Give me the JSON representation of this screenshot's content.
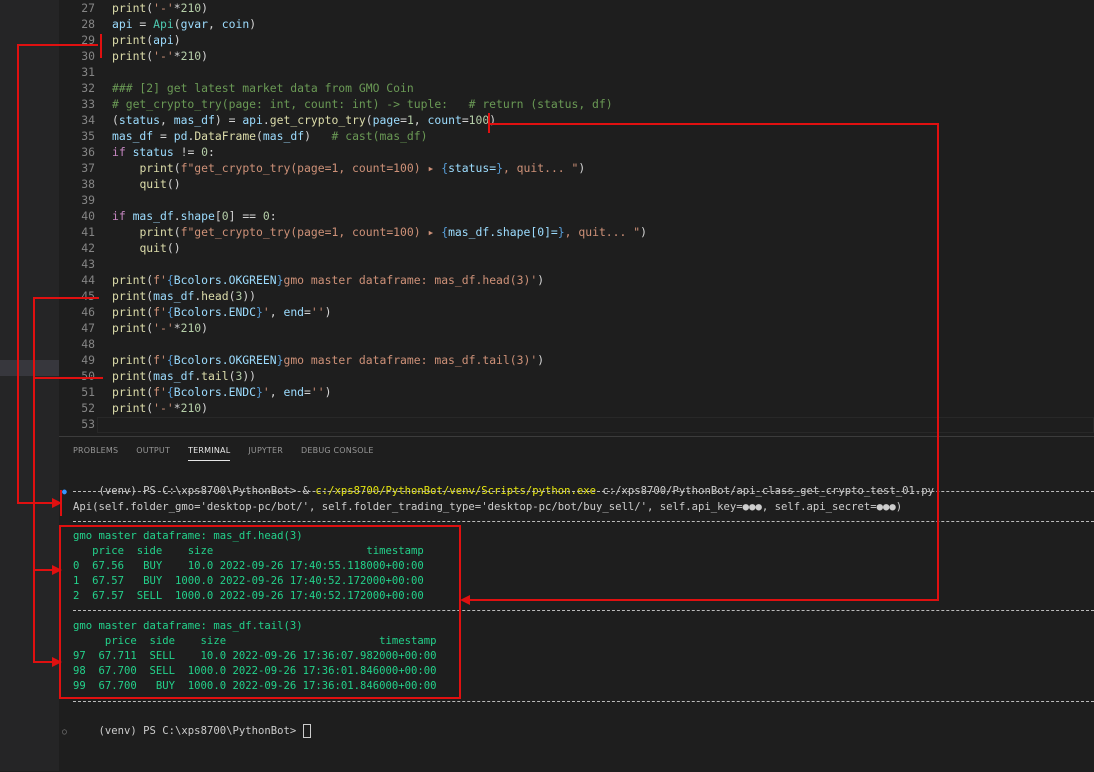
{
  "editor": {
    "lines": [
      {
        "n": "27",
        "t": "print('-'*210)"
      },
      {
        "n": "28",
        "t": "api = Api(gvar, coin)"
      },
      {
        "n": "29",
        "t": "print(api)"
      },
      {
        "n": "30",
        "t": "print('-'*210)"
      },
      {
        "n": "31",
        "t": ""
      },
      {
        "n": "32",
        "t": "### [2] get latest market data from GMO Coin"
      },
      {
        "n": "33",
        "t": "# get_crypto_try(page: int, count: int) -> tuple:   # return (status, df)"
      },
      {
        "n": "34",
        "t": "(status, mas_df) = api.get_crypto_try(page=1, count=100)"
      },
      {
        "n": "35",
        "t": "mas_df = pd.DataFrame(mas_df)   # cast(mas_df)"
      },
      {
        "n": "36",
        "t": "if status != 0:"
      },
      {
        "n": "37",
        "t": "    print(f\"get_crypto_try(page=1, count=100) ▸ {status=}, quit... \")"
      },
      {
        "n": "38",
        "t": "    quit()"
      },
      {
        "n": "39",
        "t": ""
      },
      {
        "n": "40",
        "t": "if mas_df.shape[0] == 0:"
      },
      {
        "n": "41",
        "t": "    print(f\"get_crypto_try(page=1, count=100) ▸ {mas_df.shape[0]=}, quit... \")"
      },
      {
        "n": "42",
        "t": "    quit()"
      },
      {
        "n": "43",
        "t": ""
      },
      {
        "n": "44",
        "t": "print(f'{Bcolors.OKGREEN}gmo master dataframe: mas_df.head(3)')"
      },
      {
        "n": "45",
        "t": "print(mas_df.head(3))"
      },
      {
        "n": "46",
        "t": "print(f'{Bcolors.ENDC}', end='')"
      },
      {
        "n": "47",
        "t": "print('-'*210)"
      },
      {
        "n": "48",
        "t": ""
      },
      {
        "n": "49",
        "t": "print(f'{Bcolors.OKGREEN}gmo master dataframe: mas_df.tail(3)')"
      },
      {
        "n": "50",
        "t": "print(mas_df.tail(3))"
      },
      {
        "n": "51",
        "t": "print(f'{Bcolors.ENDC}', end='')"
      },
      {
        "n": "52",
        "t": "print('-'*210)"
      },
      {
        "n": "53",
        "t": ""
      }
    ]
  },
  "panel": {
    "tabs": [
      "PROBLEMS",
      "OUTPUT",
      "TERMINAL",
      "JUPYTER",
      "DEBUG CONSOLE"
    ],
    "active_tab": "TERMINAL"
  },
  "terminal": {
    "prompt1_prefix": "(venv) PS C:\\xps8700\\PythonBot> & ",
    "prompt1_exe": "c:/xps8700/PythonBot/venv/Scripts/python.exe",
    "prompt1_arg": " c:/xps8700/PythonBot/api_class_get_crypto_test_01.py",
    "api_repr": "Api(self.folder_gmo='desktop-pc/bot/', self.folder_trading_type='desktop-pc/bot/buy_sell/', self.api_key=●●●, self.api_secret=●●●)",
    "head_title": "gmo master dataframe: mas_df.head(3)",
    "head_header": "   price  side    size                        timestamp",
    "head_rows": [
      "0  67.56   BUY    10.0 2022-09-26 17:40:55.118000+00:00",
      "1  67.57   BUY  1000.0 2022-09-26 17:40:52.172000+00:00",
      "2  67.57  SELL  1000.0 2022-09-26 17:40:52.172000+00:00"
    ],
    "tail_title": "gmo master dataframe: mas_df.tail(3)",
    "tail_header": "     price  side    size                        timestamp",
    "tail_rows": [
      "97  67.711  SELL    10.0 2022-09-26 17:36:07.982000+00:00",
      "98  67.700  SELL  1000.0 2022-09-26 17:36:01.846000+00:00",
      "99  67.700   BUY  1000.0 2022-09-26 17:36:01.846000+00:00"
    ],
    "prompt2": "(venv) PS C:\\xps8700\\PythonBot> "
  },
  "colors": {
    "annotation_red": "#e01010",
    "terminal_green": "#23d18b",
    "terminal_yellow": "#e5e510"
  }
}
